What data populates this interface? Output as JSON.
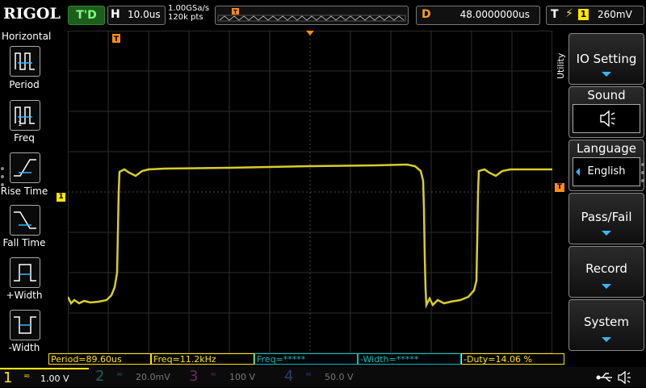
{
  "header": {
    "brand": "RIGOL",
    "run_status": "T'D",
    "horizontal_label": "H",
    "timebase": "10.0us",
    "sample_rate": "1.00GSa/s",
    "memory_depth": "120k pts",
    "trigger_marker": "T",
    "delay_label": "D",
    "delay_value": "48.0000000us",
    "trigger_label": "T",
    "trigger_source": "1",
    "trigger_level": "260mV"
  },
  "left_menu": {
    "title": "Horizontal",
    "items": [
      {
        "label": "Period",
        "icon": "period-icon"
      },
      {
        "label": "Freq",
        "icon": "frequency-icon"
      },
      {
        "label": "Rise Time",
        "icon": "rise-time-icon"
      },
      {
        "label": "Fall Time",
        "icon": "fall-time-icon"
      },
      {
        "label": "+Width",
        "icon": "positive-width-icon"
      },
      {
        "label": "-Width",
        "icon": "negative-width-icon"
      }
    ]
  },
  "display": {
    "trigger_position_marker": "T",
    "channel1_marker": "1",
    "trigger_level_marker": "T",
    "colors": {
      "channel1": "#d8cc2a",
      "grid": "#3a3a3a",
      "trigger": "#ff8c1a"
    }
  },
  "right_menu": {
    "tab": "Utility",
    "items": [
      {
        "label": "IO Setting",
        "has_arrow": true
      },
      {
        "label": "Sound",
        "icon": "speaker-icon"
      },
      {
        "label": "Language",
        "value": "English"
      },
      {
        "label": "Pass/Fail",
        "has_arrow": true
      },
      {
        "label": "Record",
        "has_arrow": true
      },
      {
        "label": "System",
        "has_arrow": true
      }
    ]
  },
  "measurements": {
    "period": "Period=89.60us",
    "freq": "Freq=11.2kHz",
    "freq2": "Freq=*****",
    "neg_width": "-Width=*****",
    "neg_duty": "-Duty=14.06 %"
  },
  "channels": [
    {
      "number": "1",
      "scale": "1.00 V",
      "color": "#ffe600"
    },
    {
      "number": "2",
      "scale": "20.0mV",
      "color": "#00c0c0"
    },
    {
      "number": "3",
      "scale": "100 V",
      "color": "#ff44ff"
    },
    {
      "number": "4",
      "scale": "50.0 V",
      "color": "#3a7aff"
    }
  ]
}
